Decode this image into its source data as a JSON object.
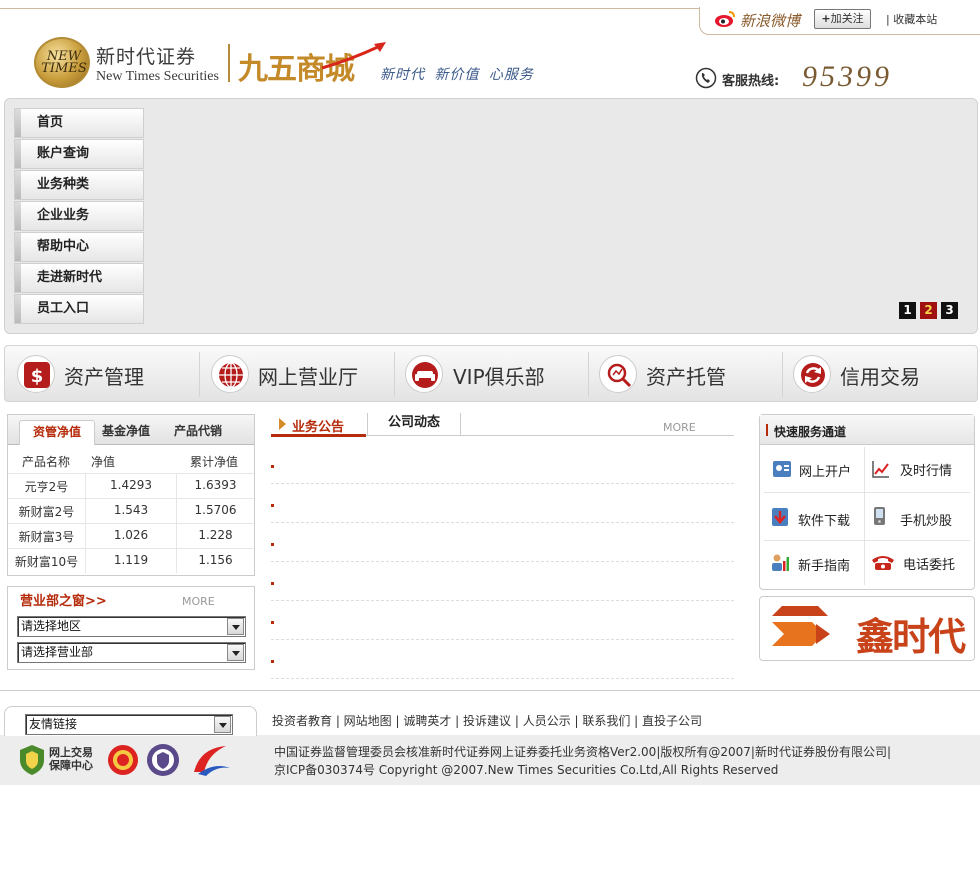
{
  "header": {
    "weibo_label": "新浪微博",
    "follow_label": "加关注",
    "favorite_label": "| 收藏本站",
    "logo_badge": "NEW TIMES",
    "company_cn": "新时代证券",
    "company_en": "New Times Securities",
    "mall_name": "九五商城",
    "slogan": "新时代 新价值 心服务",
    "hotline_label": "客服热线:",
    "hotline_number": "95399"
  },
  "nav": {
    "items": [
      "首页",
      "账户查询",
      "业务种类",
      "企业业务",
      "帮助中心",
      "走进新时代",
      "员工入口"
    ]
  },
  "slideshow": {
    "pages": [
      "1",
      "2",
      "3"
    ],
    "active_page": "2"
  },
  "services": [
    {
      "label": "资产管理",
      "icon": "dollar-icon"
    },
    {
      "label": "网上营业厅",
      "icon": "globe-icon"
    },
    {
      "label": "VIP俱乐部",
      "icon": "sofa-icon"
    },
    {
      "label": "资产托管",
      "icon": "magnifier-icon"
    },
    {
      "label": "信用交易",
      "icon": "refresh-icon"
    }
  ],
  "funds": {
    "tabs": [
      "资管净值",
      "基金净值",
      "产品代销"
    ],
    "columns": [
      "产品名称",
      "净值",
      "累计净值"
    ],
    "rows": [
      [
        "元亨2号",
        "1.4293",
        "1.6393"
      ],
      [
        "新财富2号",
        "1.543",
        "1.5706"
      ],
      [
        "新财富3号",
        "1.026",
        "1.228"
      ],
      [
        "新财富10号",
        "1.119",
        "1.156"
      ]
    ]
  },
  "branch": {
    "title": "营业部之窗>>",
    "more": "MORE",
    "region_select": "请选择地区",
    "branch_select": "请选择营业部"
  },
  "news": {
    "tabs": [
      "业务公告",
      "公司动态"
    ],
    "more": "MORE"
  },
  "quick": {
    "title": "快速服务通道",
    "items": [
      {
        "label": "网上开户",
        "icon": "id-card-icon"
      },
      {
        "label": "及时行情",
        "icon": "chart-icon"
      },
      {
        "label": "软件下载",
        "icon": "download-icon"
      },
      {
        "label": "手机炒股",
        "icon": "mobile-icon"
      },
      {
        "label": "新手指南",
        "icon": "guide-icon"
      },
      {
        "label": "电话委托",
        "icon": "telephone-icon"
      }
    ],
    "banner_text": "鑫时代"
  },
  "footer": {
    "links_select": "友情链接",
    "links": "投资者教育 | 网站地图 | 诚聘英才 | 投诉建议 | 人员公示 | 联系我们 | 直投子公司",
    "copyright1": "中国证券监督管理委员会核准新时代证券网上证券委托业务资格Ver2.00|版权所有@2007|新时代证券股份有限公司|",
    "copyright2": "京ICP备030374号 Copyright @2007.New Times Securities Co.Ltd,All Rights Reserved",
    "badge1_text": "网上交易保障中心"
  },
  "colors": {
    "accent": "#b52b0b",
    "gold": "#c48a2a",
    "slogan_blue": "#3b5a8a"
  }
}
